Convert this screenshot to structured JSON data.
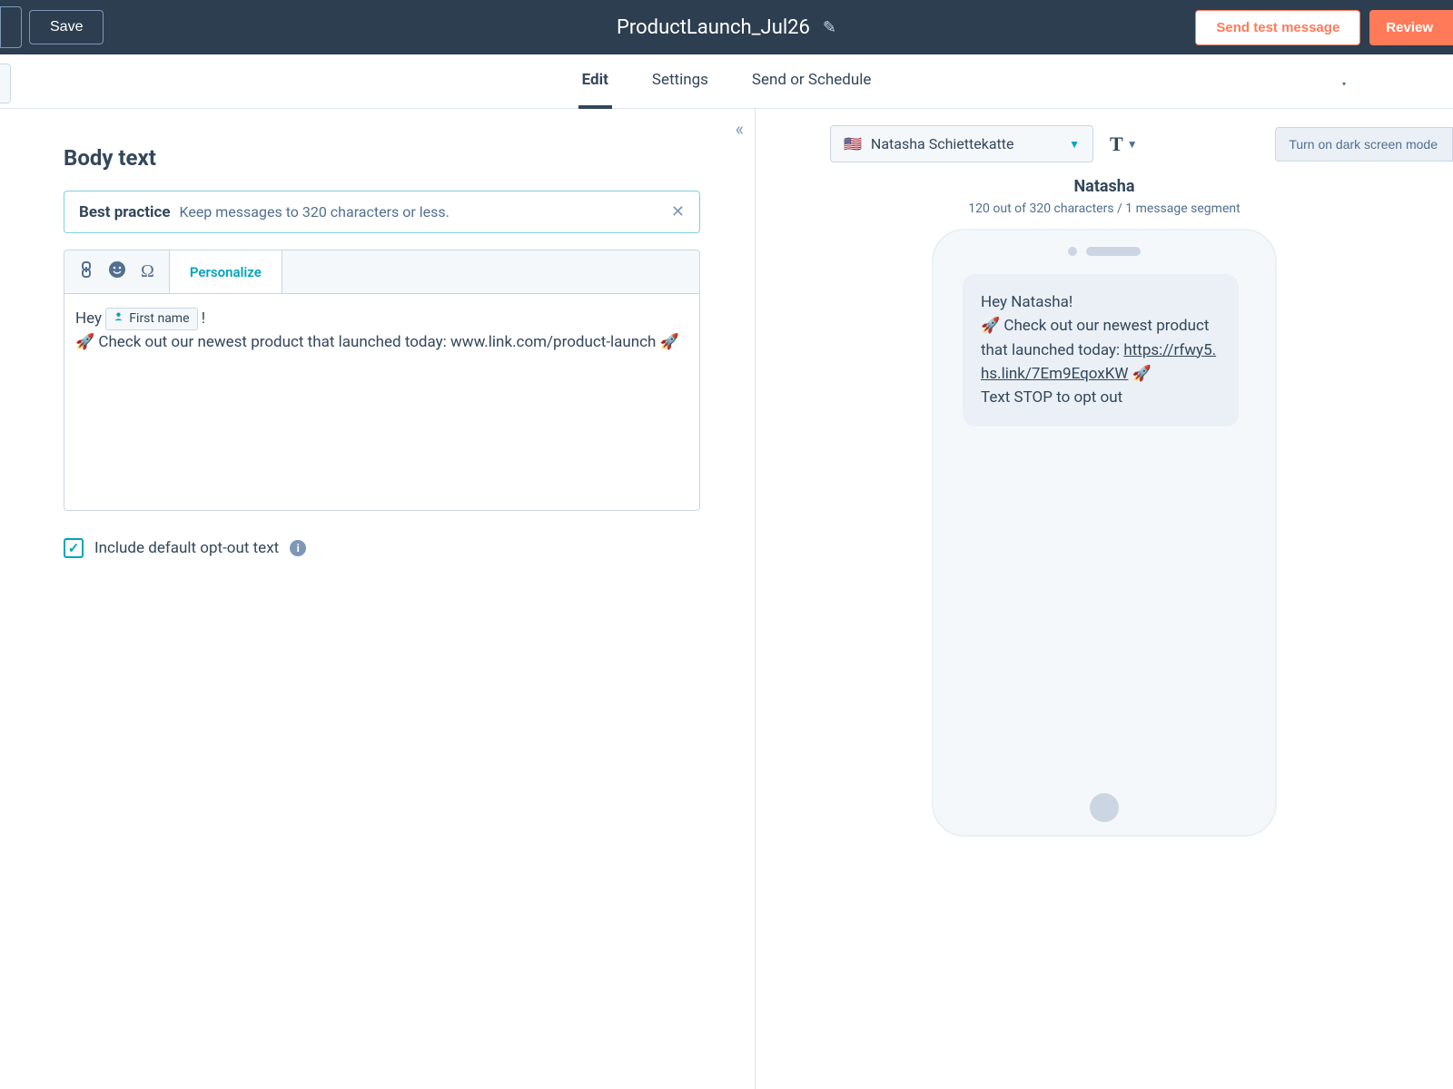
{
  "background_hint": "business results",
  "header": {
    "save_label": "Save",
    "title": "ProductLaunch_Jul26",
    "test_message_label": "Send test message",
    "review_label": "Review"
  },
  "tabs": {
    "edit": "Edit",
    "settings": "Settings",
    "send": "Send or Schedule",
    "active": "edit"
  },
  "editor": {
    "heading": "Body text",
    "best_practice": {
      "label": "Best practice",
      "text": "Keep messages to 320 characters or less."
    },
    "personalize_label": "Personalize",
    "body": {
      "prefix": "Hey ",
      "token_label": "First name",
      "after_token": " !",
      "line2": "🚀 Check out our newest product that launched today: www.link.com/product-launch 🚀"
    },
    "optout": {
      "checked": true,
      "label": "Include default opt-out text"
    }
  },
  "preview": {
    "contact": {
      "flag": "🇺🇸",
      "name": "Natasha Schiettekatte"
    },
    "darkmode_label": "Turn on dark screen mode",
    "contact_short": "Natasha",
    "char_info": "120 out of 320 characters / 1 message segment",
    "sms": {
      "line1": "Hey Natasha!",
      "line2a": "🚀 Check out our newest product that launched today: ",
      "link": "https://rfwy5.hs.link/7Em9EqoxKW",
      "line2b": " 🚀",
      "optout": "Text STOP to opt out"
    }
  }
}
